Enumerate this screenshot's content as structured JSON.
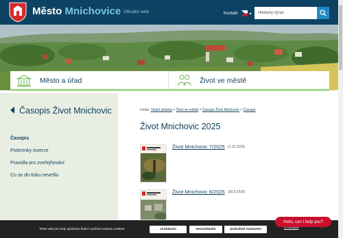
{
  "header": {
    "title_part1": "Město",
    "title_part2": "Mnichovice",
    "subtitle": "Oficiální web",
    "contact_label": "Kontakt",
    "search_placeholder": "Hledaný výraz",
    "colors": {
      "background": "#0d4262",
      "accent": "#79c4e8",
      "search_button": "#2388c7"
    }
  },
  "nav": {
    "items": [
      {
        "label": "Město a úřad",
        "icon": "town-hall-icon"
      },
      {
        "label": "Život ve městě",
        "icon": "people-icon"
      }
    ],
    "underline_color": "#9fd88b"
  },
  "sidebar": {
    "title": "Časopis Život Mnichovic",
    "items": [
      {
        "label": "Časopis",
        "active": true
      },
      {
        "label": "Podmínky inzerce",
        "active": false
      },
      {
        "label": "Pravidla pro zveřejňování",
        "active": false
      },
      {
        "label": "Co se do tisku nevešlo",
        "active": false
      }
    ]
  },
  "main": {
    "breadcrumb": {
      "prefix": "Cesta:",
      "items": [
        "Titulní stránka",
        "Život ve městě",
        "Časopis Život Mnichovic",
        "Časopis"
      ],
      "separator": ">"
    },
    "title": "Život Mnichovic 2025",
    "issues": [
      {
        "title": "Život Mnichovic 7/2025",
        "date": "(1.11.2025)"
      },
      {
        "title": "Život Mnichovic 6/2025",
        "date": "(30.9.2025)"
      }
    ]
  },
  "cookie_bar": {
    "text": "Tento web pro svoji správnou funkci využívá soubory cookies.",
    "accept_label": "souhlasím",
    "reject_label": "nesouhlasím",
    "settings_label": "podrobné nastavení",
    "link_label": "O cookies"
  },
  "chat": {
    "label": "Hello, can I help you?",
    "color": "#c8102e"
  }
}
